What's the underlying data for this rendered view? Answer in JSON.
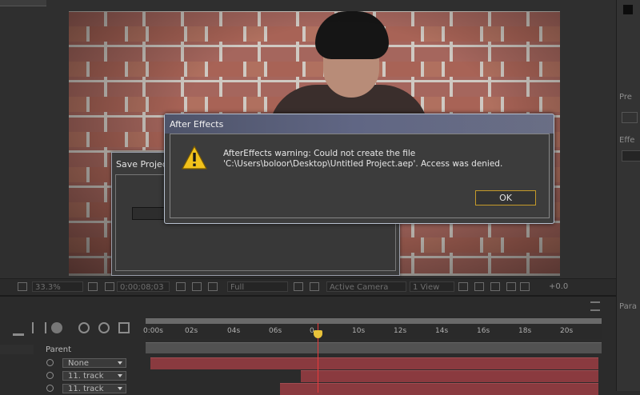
{
  "viewer": {
    "toolbar": {
      "zoom": "33.3%",
      "timecode": "0;00;08;03",
      "resolution": "Full",
      "camera": "Active Camera",
      "views": "1 View",
      "exposure": "+0.0"
    }
  },
  "save_dialog": {
    "title": "Save Projec"
  },
  "alert_dialog": {
    "title": "After Effects",
    "message": "AfterEffects warning: Could not create the file 'C:\\Users\\boloor\\Desktop\\Untitled Project.aep'. Access was denied.",
    "ok_label": "OK"
  },
  "timeline": {
    "parent_header": "Parent",
    "ruler_labels": [
      "0:00s",
      "02s",
      "04s",
      "06s",
      "0",
      "10s",
      "12s",
      "14s",
      "16s",
      "18s",
      "20s"
    ],
    "layers": [
      {
        "parent": "None"
      },
      {
        "parent": "11. track"
      },
      {
        "parent": "11. track"
      }
    ],
    "playhead_time": "0;00;08;03"
  },
  "right_panel": {
    "label_1": "Pre",
    "label_2": "Effe",
    "label_3": "Para"
  }
}
